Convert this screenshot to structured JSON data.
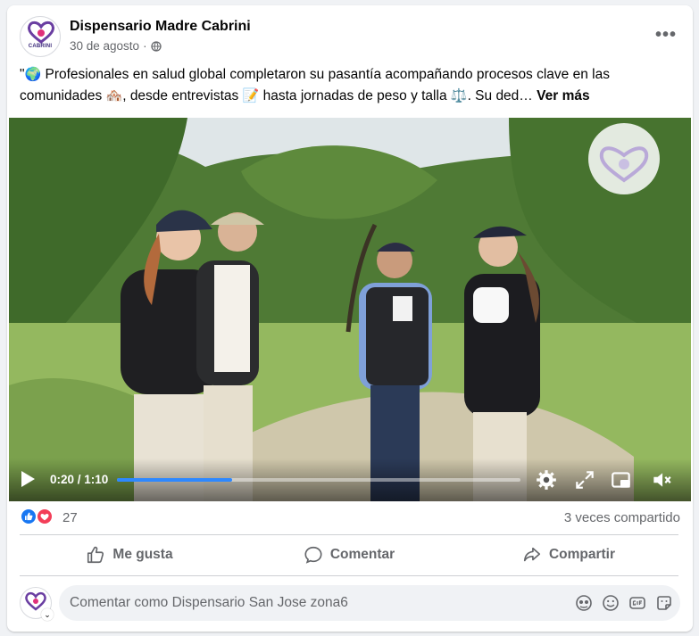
{
  "post": {
    "page_name": "Dispensario Madre Cabrini",
    "date": "30 de agosto",
    "separator": "·",
    "avatar_caption": "CABRINI",
    "text_before": "\"",
    "emoji_globe": "🌍",
    "text_part1": " Profesionales en salud global completaron su pasantía acompañando procesos clave en las comunidades ",
    "emoji_house": "🏘️",
    "text_part2": ", desde entrevistas ",
    "emoji_memo": "📝",
    "text_part3": " hasta jornadas de peso y talla ",
    "emoji_scale": "⚖️",
    "text_part4": ". Su ded…",
    "see_more": "Ver más",
    "icons": {
      "more": "more-options-icon",
      "privacy": "globe-icon"
    }
  },
  "video": {
    "time": "0:20 / 1:10",
    "progress": 0.286,
    "icons": [
      "play-icon",
      "settings-icon",
      "fullscreen-icon",
      "miniplayer-icon",
      "mute-icon"
    ]
  },
  "stats": {
    "reactions": [
      "like",
      "love"
    ],
    "count": "27",
    "shares": "3 veces compartido",
    "colors": {
      "like": "#1877f2",
      "love": "#f33e58"
    }
  },
  "actions": {
    "like": "Me gusta",
    "comment": "Comentar",
    "share": "Compartir"
  },
  "composer": {
    "placeholder": "Comentar como Dispensario San Jose zona6",
    "icons": [
      "avatar-sticker-icon",
      "emoji-icon",
      "gif-icon",
      "sticker-icon"
    ]
  }
}
